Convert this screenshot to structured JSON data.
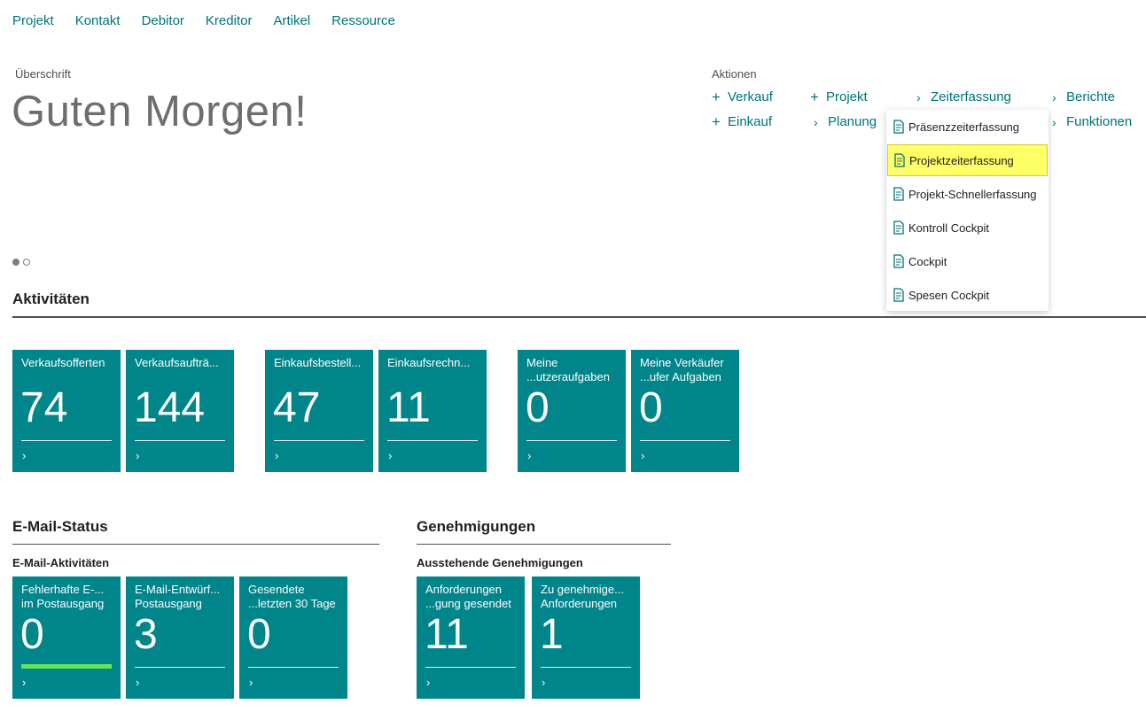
{
  "nav": [
    "Projekt",
    "Kontakt",
    "Debitor",
    "Kreditor",
    "Artikel",
    "Ressource"
  ],
  "headline": {
    "caption": "Überschrift",
    "greeting": "Guten Morgen!"
  },
  "actions": {
    "caption": "Aktionen",
    "verkauf": "Verkauf",
    "projekt": "Projekt",
    "zeiterfassung": "Zeiterfassung",
    "berichte": "Berichte",
    "einkauf": "Einkauf",
    "planung": "Planung",
    "funktionen": "Funktionen"
  },
  "zeiterfassung_menu": [
    "Präsenzzeiterfassung",
    "Projektzeiterfassung",
    "Projekt-Schnellerfassung",
    "Kontroll Cockpit",
    "Cockpit",
    "Spesen Cockpit"
  ],
  "highlighted_menu_item": "Projektzeiterfassung",
  "activities": {
    "title": "Aktivitäten",
    "tiles": [
      {
        "label": "Verkaufsofferten",
        "value": "74"
      },
      {
        "label": "Verkaufsaufträ...",
        "value": "144"
      },
      {
        "label": "Einkaufsbestell...",
        "value": "47"
      },
      {
        "label": "Einkaufsrechn...",
        "value": "11"
      },
      {
        "label": "Meine ...utzeraufgaben",
        "value": "0"
      },
      {
        "label": "Meine Verkäufer ...ufer Aufgaben",
        "value": "0"
      }
    ]
  },
  "email": {
    "title": "E-Mail-Status",
    "subtitle": "E-Mail-Aktivitäten",
    "tiles": [
      {
        "label": "Fehlerhafte E-... im Postausgang",
        "value": "0"
      },
      {
        "label": "E-Mail-Entwürf... Postausgang",
        "value": "3"
      },
      {
        "label": "Gesendete ...letzten 30 Tage",
        "value": "0"
      }
    ]
  },
  "approvals": {
    "title": "Genehmigungen",
    "subtitle": "Ausstehende Genehmigungen",
    "tiles": [
      {
        "label": "Anforderungen ...gung gesendet",
        "value": "11"
      },
      {
        "label": "Zu genehmige... Anforderungen",
        "value": "1"
      }
    ]
  },
  "colors": {
    "accent": "#00727a",
    "tile": "#00858a",
    "highlight": "#ffff66",
    "ok_bar": "#64e65a"
  },
  "icons": {
    "plus": "plus-icon",
    "chevron": "chevron-right-icon",
    "menu_item": "report-page-icon",
    "carousel": "carousel-dot-icon"
  }
}
